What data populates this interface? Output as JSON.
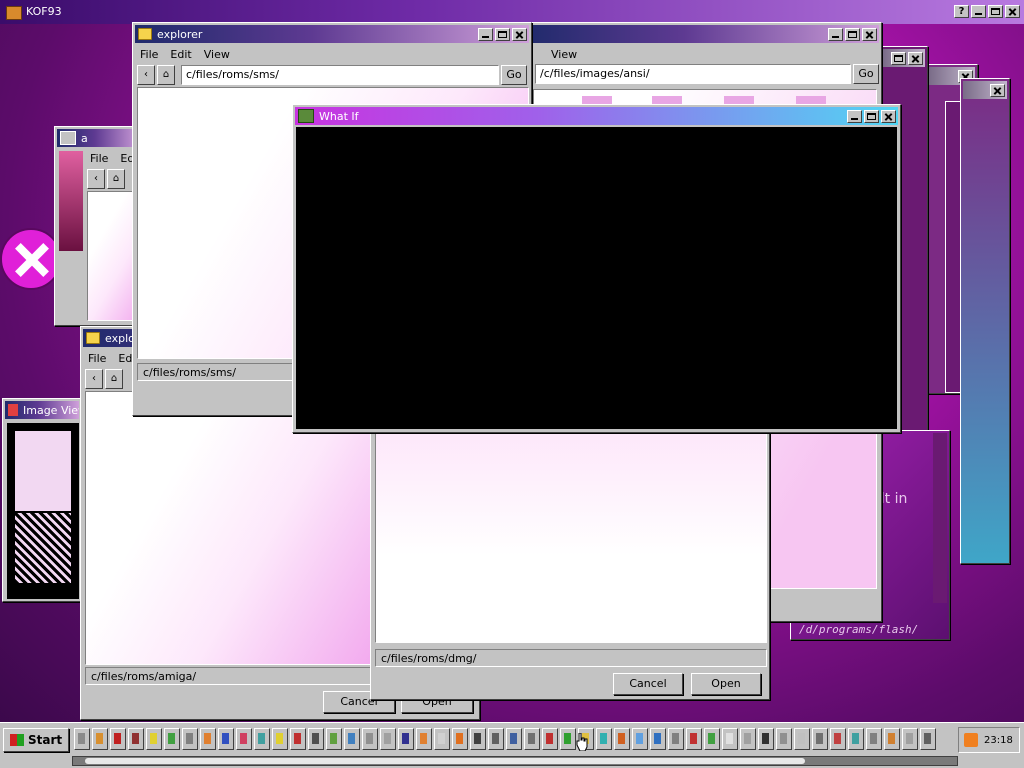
{
  "desktop": {
    "app_title": "KOF93"
  },
  "windows": {
    "explorer_sms": {
      "title": "explorer",
      "menu": [
        "File",
        "Edit",
        "View"
      ],
      "path": "c/files/roms/sms/",
      "go": "Go",
      "status": "c/files/roms/sms/"
    },
    "explorer_ansi": {
      "menu_view": "View",
      "path": "/c/files/images/ansi/",
      "go": "Go"
    },
    "what_if": {
      "title": "What If"
    },
    "small_a": {
      "title": "a",
      "menu": [
        "File",
        "Ed"
      ]
    },
    "explorer_amiga": {
      "title": "explo",
      "menu": [
        "File",
        "Ed"
      ],
      "status": "c/files/roms/amiga/",
      "cancel": "Cancel",
      "open": "Open"
    },
    "dmg_dialog": {
      "status": "c/files/roms/dmg/",
      "cancel": "Cancel",
      "open": "Open"
    },
    "image_viewer": {
      "title": "Image View"
    },
    "flash_window": {
      "warning_text": "te may result in",
      "path": "/d/programs/flash/"
    }
  },
  "taskbar": {
    "start_label": "Start",
    "clock": "23:18"
  },
  "colors": {
    "titlebar_active": "#1f2a6b",
    "what_if_gradient_start": "#c834e0",
    "what_if_gradient_end": "#50d6f4",
    "error_badge": "#e020d8"
  }
}
